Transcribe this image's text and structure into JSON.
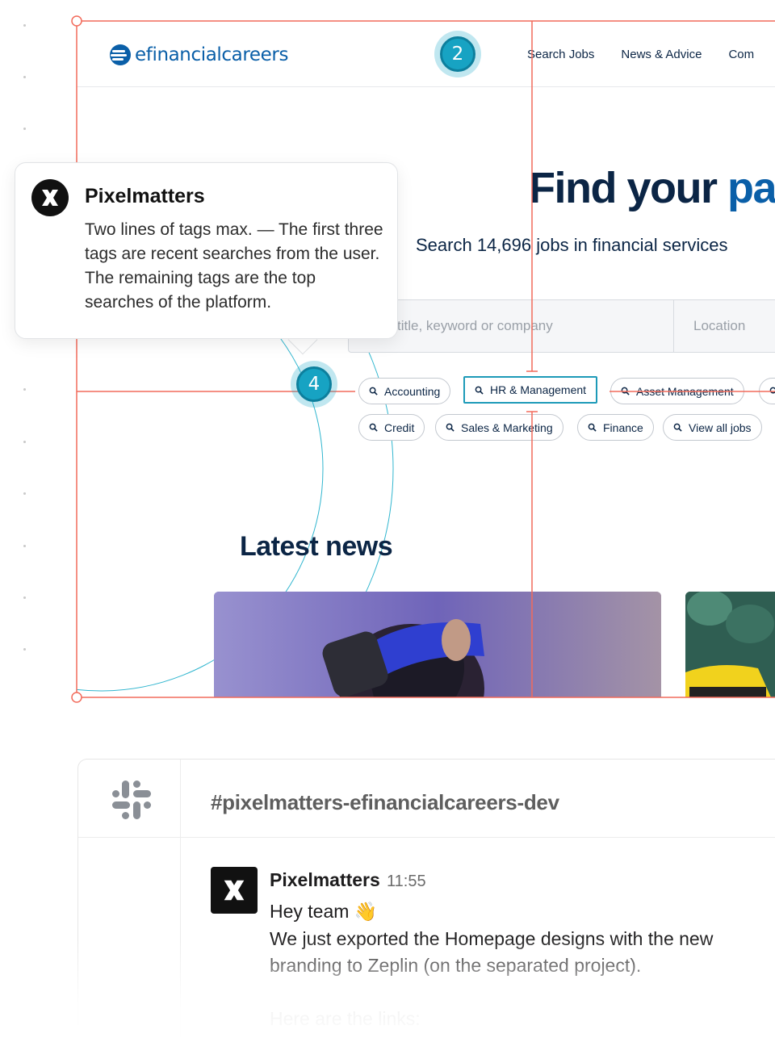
{
  "site": {
    "logo_text": "efinancialcareers",
    "nav": [
      "Search Jobs",
      "News & Advice",
      "Com"
    ],
    "hero_title_main": "Find your ",
    "hero_title_accent": "pa",
    "hero_subtitle": "Search 14,696 jobs in financial services",
    "keyword_placeholder": "title, keyword or company",
    "location_placeholder": "Location",
    "tags": [
      "Accounting",
      "HR & Management",
      "Asset Management",
      "Credit",
      "Sales & Marketing",
      "Finance",
      "View all jobs"
    ],
    "news_heading": "Latest news"
  },
  "annotations": {
    "badge_top": "2",
    "badge_tags": "4"
  },
  "tooltip": {
    "author": "Pixelmatters",
    "text": "Two lines of tags max. — The first three tags are recent searches from the user. The remaining tags are the top searches of the platform."
  },
  "slack": {
    "channel": "#pixelmatters-efinancialcareers-dev",
    "author": "Pixelmatters",
    "time": "11:55",
    "greeting": "Hey team",
    "emoji": "👋",
    "line_1": "We just exported the Homepage designs with the new",
    "line_2": "branding to Zeplin (on the separated project).",
    "line_3": "Here are the links:"
  },
  "colors": {
    "brand_blue": "#0a5fa8",
    "navy": "#0b2545",
    "redline": "#f26b5b",
    "badge_teal": "#17a3c3"
  }
}
